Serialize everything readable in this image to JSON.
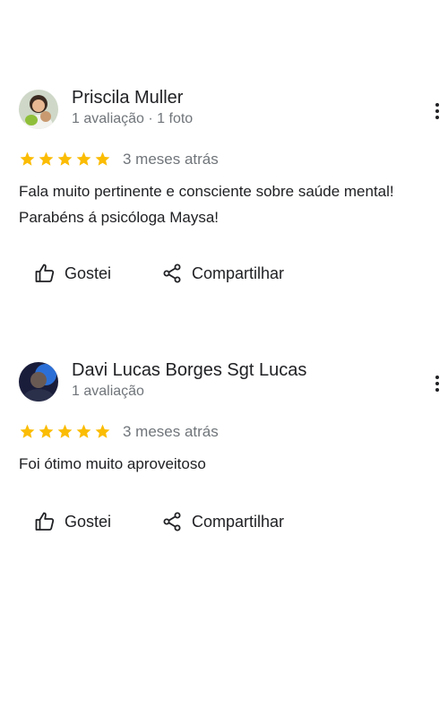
{
  "colors": {
    "star": "#fbbc04",
    "text_primary": "#202124",
    "text_secondary": "#70757a"
  },
  "reviews": [
    {
      "author": "Priscila Muller",
      "meta": "1 avaliação · 1 foto",
      "rating": 5,
      "date": "3 meses atrás",
      "text": "Fala muito pertinente e consciente sobre saúde mental! Parabéns á psicóloga Maysa!",
      "like_label": "Gostei",
      "share_label": "Compartilhar",
      "avatar_icon": "avatar-photo-icon"
    },
    {
      "author": "Davi Lucas Borges Sgt Lucas",
      "meta": "1 avaliação",
      "rating": 5,
      "date": "3 meses atrás",
      "text": "Foi ótimo muito aproveitoso",
      "like_label": "Gostei",
      "share_label": "Compartilhar",
      "avatar_icon": "avatar-photo-icon"
    }
  ]
}
